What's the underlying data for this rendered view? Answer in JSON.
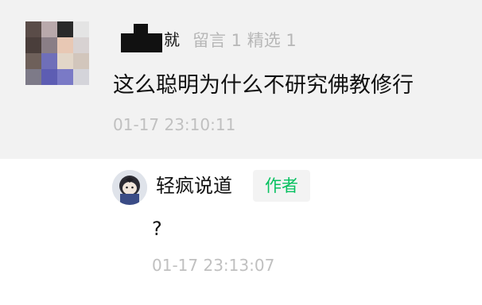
{
  "comment": {
    "author_visible_char": "就",
    "meta": "留言 1 精选 1",
    "text": "这么聪明为什么不研究佛教修行",
    "time": "01-17 23:10:11"
  },
  "reply": {
    "author": "轻疯说道",
    "badge": "作者",
    "text": "?",
    "time": "01-17 23:13:07"
  },
  "colors": {
    "badge_text": "#07c160",
    "meta_text": "#b7b7b7",
    "time_text": "#c0c0c0",
    "comment_bg": "#f2f2f2"
  }
}
